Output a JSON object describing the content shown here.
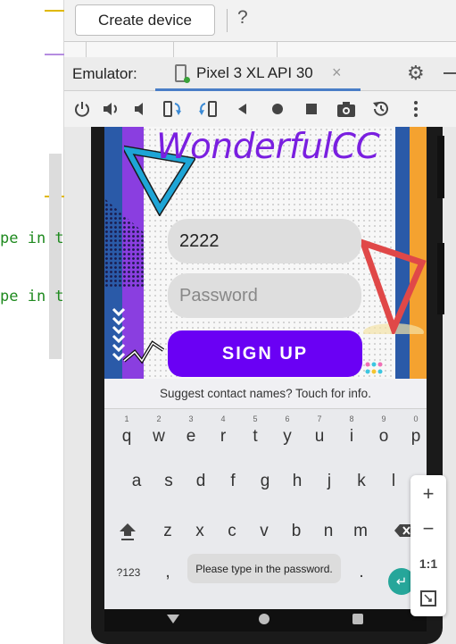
{
  "toolbar": {
    "create_device": "Create device",
    "help": "?"
  },
  "code_editor": {
    "line1": "pe in t",
    "line2": "pe in t"
  },
  "emulator": {
    "label": "Emulator:",
    "tab_label": "Pixel 3 XL API 30",
    "close": "×"
  },
  "app": {
    "title": "WonderfulCC",
    "username_value": "2222",
    "password_placeholder": "Password",
    "signup_label": "SIGN UP"
  },
  "keyboard": {
    "suggestion": "Suggest contact names? Touch for info.",
    "row1": [
      {
        "hint": "1",
        "ch": "q"
      },
      {
        "hint": "2",
        "ch": "w"
      },
      {
        "hint": "3",
        "ch": "e"
      },
      {
        "hint": "4",
        "ch": "r"
      },
      {
        "hint": "5",
        "ch": "t"
      },
      {
        "hint": "6",
        "ch": "y"
      },
      {
        "hint": "7",
        "ch": "u"
      },
      {
        "hint": "8",
        "ch": "i"
      },
      {
        "hint": "9",
        "ch": "o"
      },
      {
        "hint": "0",
        "ch": "p"
      }
    ],
    "row2": [
      "a",
      "s",
      "d",
      "f",
      "g",
      "h",
      "j",
      "k",
      "l"
    ],
    "row3": [
      "z",
      "x",
      "c",
      "v",
      "b",
      "n",
      "m"
    ],
    "symbols_key": "?123",
    "comma_key": ",",
    "period_key": ".",
    "toast": "Please type in the password."
  },
  "zoom": {
    "zoom_in": "+",
    "zoom_out": "−",
    "actual_size": "1:1"
  },
  "colors": {
    "accent_purple": "#6a00f4",
    "title_purple": "#7a1fe0",
    "enter_teal": "#26a69a",
    "tab_underline": "#4a7ec7"
  },
  "icons": [
    "power-icon",
    "volume-up-icon",
    "volume-down-icon",
    "rotate-left-icon",
    "rotate-right-icon",
    "back-icon",
    "home-icon",
    "overview-icon",
    "camera-icon",
    "snapshot-icon",
    "more-icon",
    "gear-icon",
    "help-icon",
    "shift-icon",
    "backspace-icon",
    "enter-icon"
  ]
}
